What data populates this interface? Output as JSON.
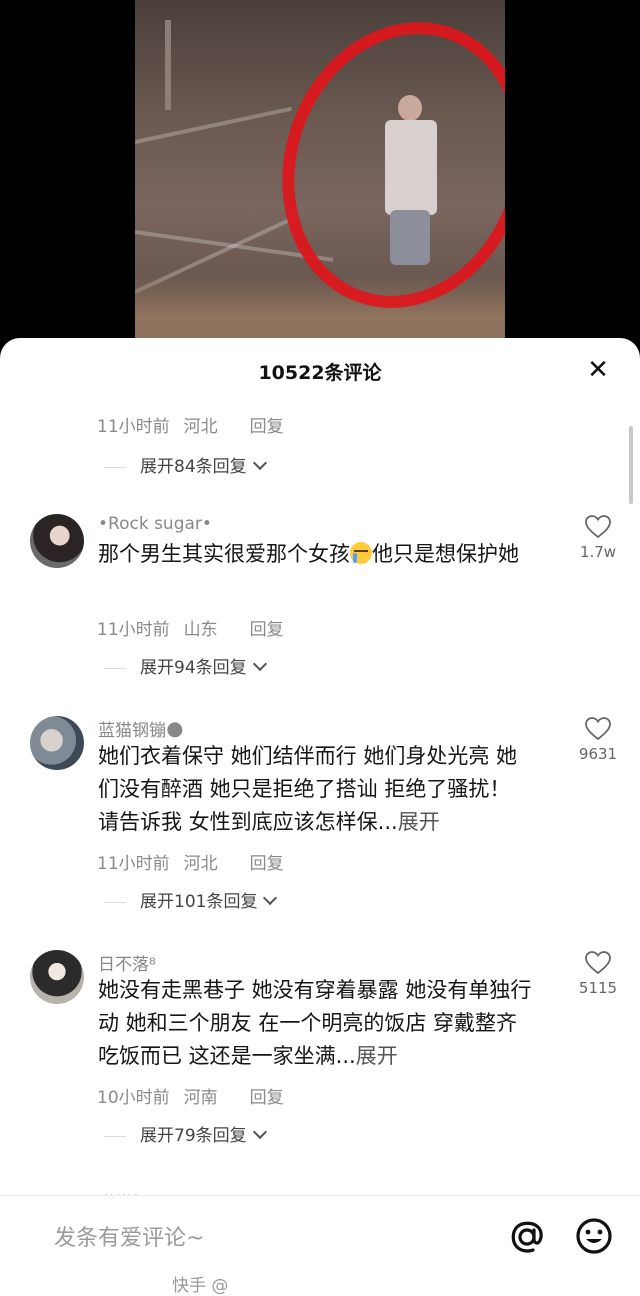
{
  "header": {
    "title": "10522条评论",
    "close_icon": "close-icon"
  },
  "prev_comment": {
    "time": "11小时前",
    "location": "河北",
    "reply_label": "回复",
    "expand_label": "展开84条回复"
  },
  "comments": [
    {
      "username": "•Rock sugar•",
      "text_before": "那个男生其实很爱那个女孩",
      "text_after": "他只是想保护她",
      "time": "11小时前",
      "location": "山东",
      "reply_label": "回复",
      "likes": "1.7w",
      "expand_label": "展开94条回复"
    },
    {
      "username": "蓝猫钢镚🌑",
      "text": "她们衣着保守 她们结伴而行 她们身处光亮 她们没有醉酒 她只是拒绝了搭讪 拒绝了骚扰！ 请告诉我 女性到底应该怎样保...",
      "more_label": "展开",
      "time": "11小时前",
      "location": "河北",
      "reply_label": "回复",
      "likes": "9631",
      "expand_label": "展开101条回复"
    },
    {
      "username": "日不落⁸",
      "text": "她没有走黑巷子  她没有穿着暴露  她没有单独行动  她和三个朋友 在一个明亮的饭店  穿戴整齐 吃饭而已 这还是一家坐满...",
      "more_label": "展开",
      "time": "10小时前",
      "location": "河南",
      "reply_label": "回复",
      "likes": "5115",
      "expand_label": "展开79条回复"
    }
  ],
  "partial_username": "湛棋奴",
  "input": {
    "placeholder": "发条有爱评论~",
    "at_icon": "at-icon",
    "emoji_icon": "emoji-icon",
    "watermark": "快手 @"
  }
}
